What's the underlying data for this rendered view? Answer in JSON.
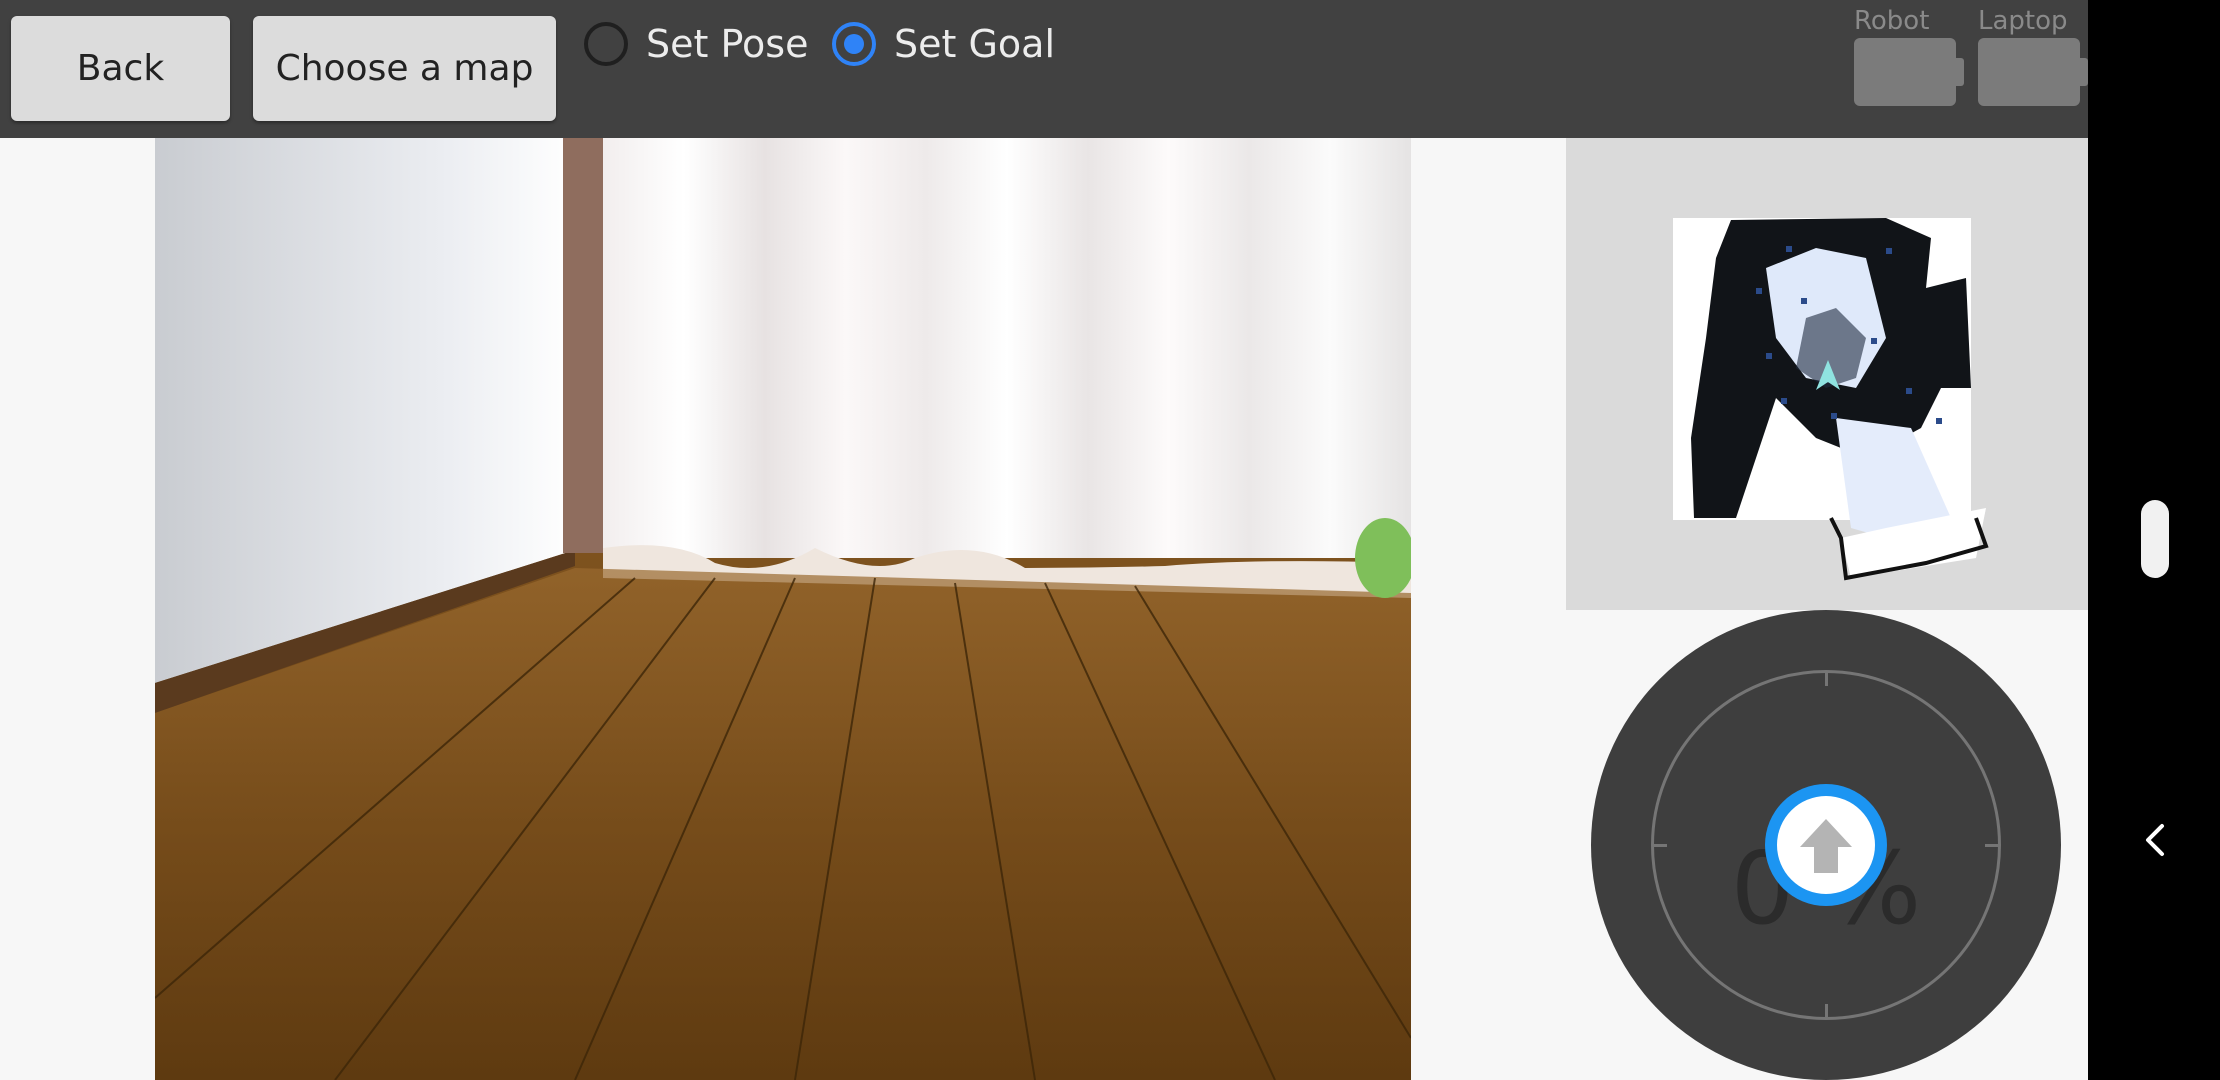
{
  "toolbar": {
    "back_label": "Back",
    "choose_map_label": "Choose a map",
    "set_pose_label": "Set Pose",
    "set_goal_label": "Set Goal",
    "selected_mode": "Set Goal"
  },
  "status": {
    "robot_label": "Robot",
    "laptop_label": "Laptop"
  },
  "joystick": {
    "percent": "0 %"
  },
  "colors": {
    "accent": "#2f83f7",
    "toolbar_bg": "#414141",
    "joystick_bg": "#3e3e3e",
    "knob": "#1c95f2"
  },
  "icons": {
    "knob": "arrow-up-icon",
    "nav_back": "chevron-left-icon"
  }
}
